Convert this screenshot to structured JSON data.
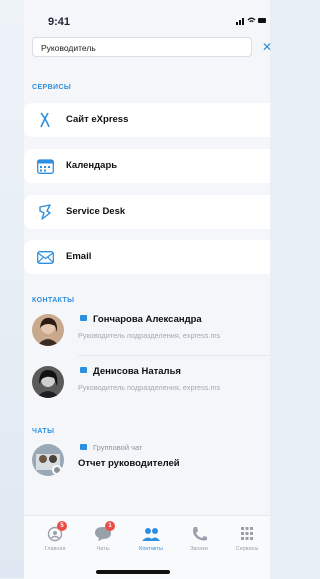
{
  "status_bar": {
    "time": "9:41",
    "icons": "signal wifi battery"
  },
  "search": {
    "value": "Руководитель",
    "clear_label": "✕"
  },
  "services": {
    "title": "СЕРВИСЫ",
    "items": [
      {
        "label": "Сайт eXpress",
        "icon": "express-x-icon"
      },
      {
        "label": "Календарь",
        "icon": "calendar-icon"
      },
      {
        "label": "Service Desk",
        "icon": "service-desk-icon"
      },
      {
        "label": "Email",
        "icon": "email-icon"
      }
    ]
  },
  "contacts": {
    "title": "КОНТАКТЫ",
    "items": [
      {
        "name": "Гончарова Александра",
        "subtitle": "Руководитель подразделения, express.ms"
      },
      {
        "name": "Денисова Наталья",
        "subtitle": "Руководитель подразделения, express.ms"
      }
    ]
  },
  "chats": {
    "title": "ЧАТЫ",
    "items": [
      {
        "type": "Групповой чат",
        "name": "Отчет руководителей"
      }
    ]
  },
  "tabbar": {
    "items": [
      {
        "label": "Главная",
        "badge": "5"
      },
      {
        "label": "Чаты",
        "badge": "1"
      },
      {
        "label": "Контакты",
        "active": true
      },
      {
        "label": "Звонки"
      },
      {
        "label": "Сервисы"
      }
    ]
  },
  "colors": {
    "accent": "#2d8fe0",
    "badge": "#ec4d47"
  }
}
